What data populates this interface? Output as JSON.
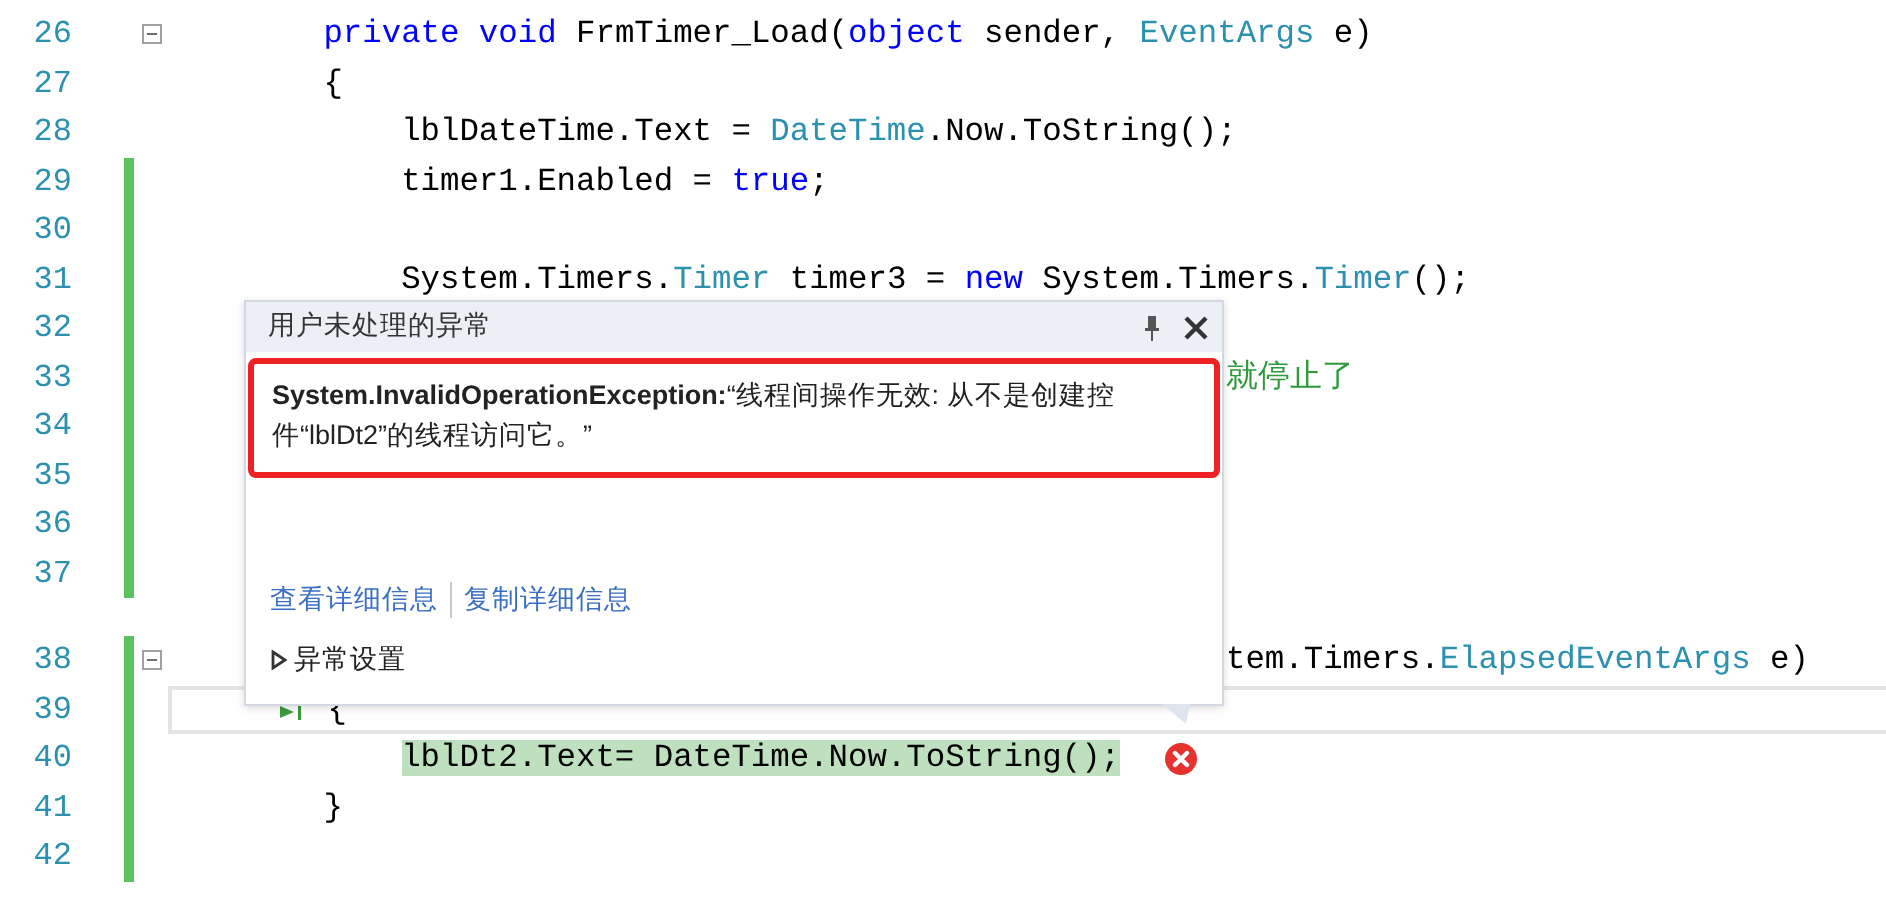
{
  "editor": {
    "lines": [
      {
        "number": "26",
        "kind": "code",
        "changed": false,
        "fold": true,
        "tokens": [
          {
            "text": "        private",
            "color": "#0000ff"
          },
          {
            "text": " void",
            "color": "#0000ff"
          },
          {
            "text": " FrmTimer_Load(",
            "color": "#000000"
          },
          {
            "text": "object",
            "color": "#0000ff"
          },
          {
            "text": " sender, ",
            "color": "#000000"
          },
          {
            "text": "EventArgs",
            "color": "#2b91af"
          },
          {
            "text": " e)",
            "color": "#000000"
          }
        ]
      },
      {
        "number": "27",
        "kind": "code",
        "changed": false,
        "fold": false,
        "tokens": [
          {
            "text": "        {",
            "color": "#000000"
          }
        ]
      },
      {
        "number": "28",
        "kind": "code",
        "changed": false,
        "fold": false,
        "tokens": [
          {
            "text": "            lblDateTime.Text = ",
            "color": "#000000"
          },
          {
            "text": "DateTime",
            "color": "#2b91af"
          },
          {
            "text": ".Now.ToString();",
            "color": "#000000"
          }
        ]
      },
      {
        "number": "29",
        "kind": "code",
        "changed": true,
        "fold": false,
        "tokens": [
          {
            "text": "            timer1.Enabled = ",
            "color": "#000000"
          },
          {
            "text": "true",
            "color": "#0000ff"
          },
          {
            "text": ";",
            "color": "#000000"
          }
        ]
      },
      {
        "number": "30",
        "kind": "code",
        "changed": true,
        "fold": false
      },
      {
        "number": "31",
        "kind": "code",
        "changed": true,
        "fold": false,
        "tokens": [
          {
            "text": "            System.Timers.",
            "color": "#000000"
          },
          {
            "text": "Timer",
            "color": "#2b91af"
          },
          {
            "text": " timer3 = ",
            "color": "#000000"
          },
          {
            "text": "new",
            "color": "#0000ff"
          },
          {
            "text": " System.Timers.",
            "color": "#000000"
          },
          {
            "text": "Timer",
            "color": "#2b91af"
          },
          {
            "text": "();",
            "color": "#000000"
          }
        ]
      },
      {
        "number": "32",
        "kind": "code",
        "changed": true,
        "fold": false
      },
      {
        "number": "33",
        "kind": "overlapped",
        "changed": true,
        "fold": false,
        "tokens": [
          {
            "text": "就停止了",
            "color": "#2e9a3c"
          }
        ]
      },
      {
        "number": "34",
        "kind": "code",
        "changed": true,
        "fold": false
      },
      {
        "number": "35",
        "kind": "code",
        "changed": true,
        "fold": false
      },
      {
        "number": "36",
        "kind": "code",
        "changed": true,
        "fold": false
      },
      {
        "number": "37",
        "kind": "code",
        "changed": true,
        "fold": false
      },
      {
        "number": "38",
        "kind": "overlapped-codelens",
        "changed": true,
        "fold": true,
        "tokens": [
          {
            "text": "tem.Timers.",
            "color": "#000000"
          },
          {
            "text": "ElapsedEventArgs",
            "color": "#2b91af"
          },
          {
            "text": " e)",
            "color": "#000000"
          }
        ]
      },
      {
        "number": "39",
        "kind": "current",
        "changed": true,
        "fold": false,
        "tokens": [
          {
            "text": "        {",
            "color": "#000000"
          }
        ]
      },
      {
        "number": "40",
        "kind": "error",
        "changed": true,
        "fold": false,
        "tokens": [
          {
            "text": "            lblDt2.Text= DateTime.Now.ToString();",
            "color": "#000000"
          }
        ]
      },
      {
        "number": "41",
        "kind": "code",
        "changed": true,
        "fold": false,
        "tokens": [
          {
            "text": "        }",
            "color": "#000000"
          }
        ]
      },
      {
        "number": "42",
        "kind": "code",
        "changed": true,
        "fold": false
      }
    ]
  },
  "exception_popup": {
    "title": "用户未处理的异常",
    "message": "**System.InvalidOperationException:**“线程间操作无效: 从不是创建控件“lblDt2”的线程访问它。”",
    "links": [
      "查看详细信息",
      "复制详细信息"
    ],
    "settings": {
      "label": "异常设置",
      "expanded": false
    }
  }
}
